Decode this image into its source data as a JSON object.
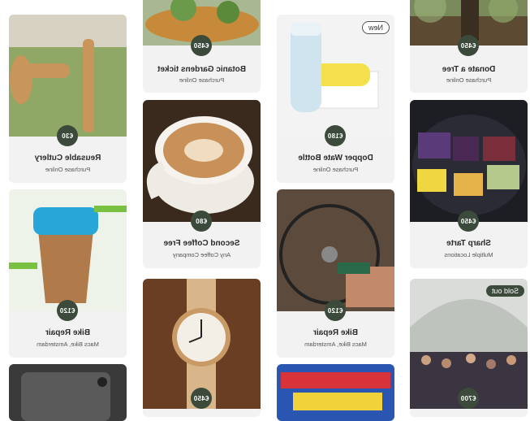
{
  "cards": [
    {
      "key": "donate",
      "price": "€450",
      "title": "Donate a Tree",
      "subtitle": "Purchase Online"
    },
    {
      "key": "botanic",
      "price": "€450",
      "title": "Botanic Gardens ticket",
      "subtitle": "Purchase Online"
    },
    {
      "key": "cutlery",
      "price": "€30",
      "title": "Reusable Cutlery",
      "subtitle": "Purchase Online"
    },
    {
      "key": "bottle",
      "price": "€180",
      "title": "Dopper Wate Bottle",
      "subtitle": "Purchase Online",
      "badge": "New"
    },
    {
      "key": "coffee",
      "price": "€80",
      "title": "Second Coffee Free",
      "subtitle": "Any Coffee Company"
    },
    {
      "key": "tarte",
      "price": "€450",
      "title": "Sharp Tarte",
      "subtitle": "Multiple Locations"
    },
    {
      "key": "cup",
      "price": "€120",
      "title": "Bike Repair",
      "subtitle": "Macs Bike, Amsterdam"
    },
    {
      "key": "bike",
      "price": "€120",
      "title": "Bike Repair",
      "subtitle": "Macs Bike, Amsterdam"
    },
    {
      "key": "watch",
      "price": "€450"
    },
    {
      "key": "phone"
    },
    {
      "key": "chocolate"
    },
    {
      "key": "festival",
      "price": "€700",
      "badge": "Sold out"
    }
  ],
  "colors": {
    "accent": "#3b4a3a",
    "card_bg": "#f2f2f2"
  }
}
